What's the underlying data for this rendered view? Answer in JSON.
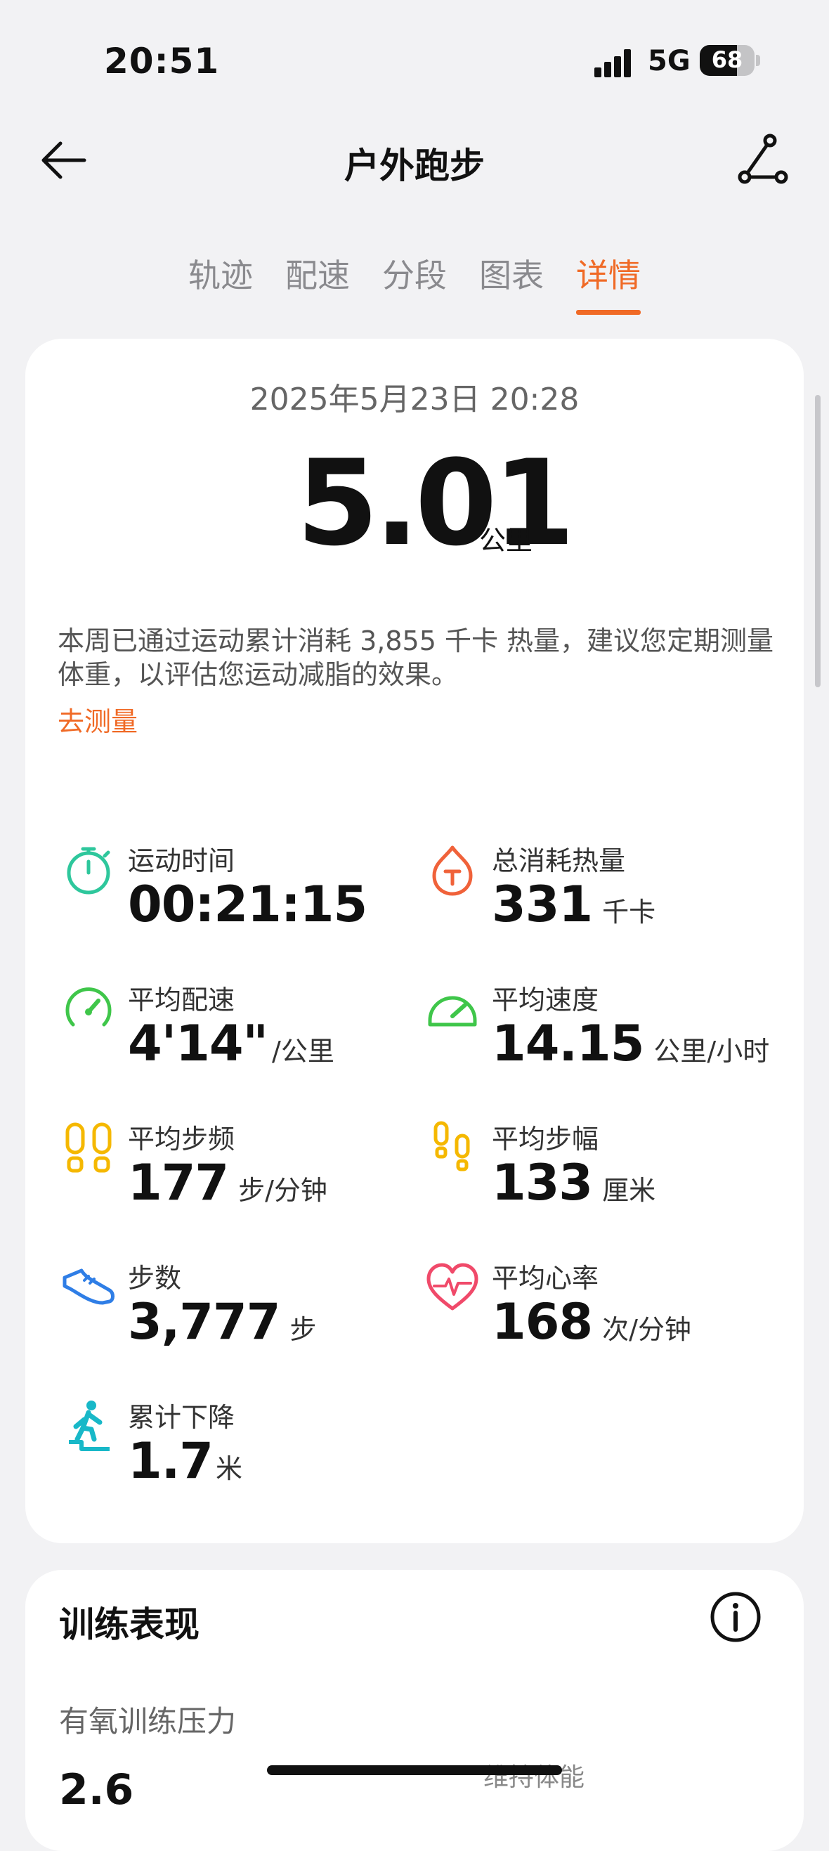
{
  "status_bar": {
    "time": "20:51",
    "network": "5G",
    "battery": "68",
    "battery_level": 0.68
  },
  "header": {
    "title": "户外跑步"
  },
  "tabs": [
    {
      "label": "轨迹",
      "active": false
    },
    {
      "label": "配速",
      "active": false
    },
    {
      "label": "分段",
      "active": false
    },
    {
      "label": "图表",
      "active": false
    },
    {
      "label": "详情",
      "active": true
    }
  ],
  "summary": {
    "datetime": "2025年5月23日 20:28",
    "distance": "5.01",
    "distance_unit": "公里",
    "advice": "本周已通过运动累计消耗 3,855 千卡 热量，建议您定期测量体重，以评估您运动减脂的效果。",
    "measure_link": "去测量"
  },
  "metrics": {
    "duration": {
      "label": "运动时间",
      "value": "00:21:15",
      "unit": "",
      "icon": "stopwatch-icon",
      "color": "#2ec79c"
    },
    "calories": {
      "label": "总消耗热量",
      "value": "331",
      "unit": "千卡",
      "icon": "flame-icon",
      "color": "#f0623a"
    },
    "avg_pace": {
      "label": "平均配速",
      "value": "4'14\"",
      "unit": "/公里",
      "icon": "gauge-icon",
      "color": "#3fc64a"
    },
    "avg_speed": {
      "label": "平均速度",
      "value": "14.15",
      "unit": "公里/小时",
      "icon": "speedometer-icon",
      "color": "#3fc64a"
    },
    "avg_cadence": {
      "label": "平均步频",
      "value": "177",
      "unit": "步/分钟",
      "icon": "footprints-icon",
      "color": "#f5b800"
    },
    "avg_stride": {
      "label": "平均步幅",
      "value": "133",
      "unit": "厘米",
      "icon": "footprints-icon",
      "color": "#f5b800"
    },
    "steps": {
      "label": "步数",
      "value": "3,777",
      "unit": "步",
      "icon": "shoe-icon",
      "color": "#2f7ee6"
    },
    "avg_heart_rate": {
      "label": "平均心率",
      "value": "168",
      "unit": "次/分钟",
      "icon": "heart-rate-icon",
      "color": "#f04a6a"
    },
    "total_descent": {
      "label": "累计下降",
      "value": "1.7",
      "unit": "米",
      "icon": "descent-icon",
      "color": "#18b8c8"
    }
  },
  "training": {
    "title": "训练表现",
    "aerobic_label": "有氧训练压力",
    "aerobic_value": "2.6",
    "aerobic_status": "维持体能"
  }
}
